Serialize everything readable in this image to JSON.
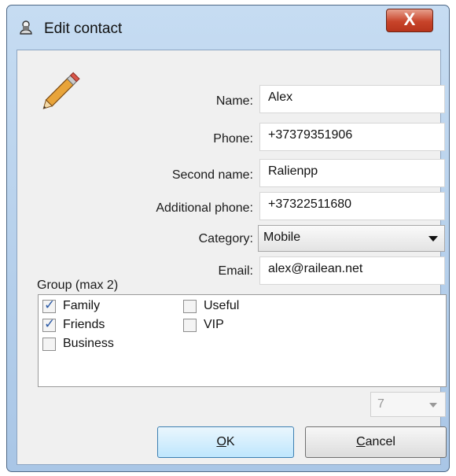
{
  "window": {
    "title": "Edit contact",
    "close_glyph": "X"
  },
  "form": {
    "name": {
      "label": "Name:",
      "value": "Alex"
    },
    "phone": {
      "label": "Phone:",
      "value": "+37379351906"
    },
    "second_name": {
      "label": "Second name:",
      "value": "Ralienpp"
    },
    "additional_phone": {
      "label": "Additional phone:",
      "value": "+37322511680"
    },
    "category": {
      "label": "Category:",
      "value": "Mobile"
    },
    "email": {
      "label": "Email:",
      "value": "alex@railean.net"
    }
  },
  "group": {
    "label": "Group (max 2)",
    "items": [
      {
        "label": "Family",
        "checked": true
      },
      {
        "label": "Friends",
        "checked": true
      },
      {
        "label": "Business",
        "checked": false
      },
      {
        "label": "Useful",
        "checked": false
      },
      {
        "label": "VIP",
        "checked": false
      }
    ]
  },
  "spinner": {
    "value": "7"
  },
  "buttons": {
    "ok": {
      "mnemonic": "O",
      "rest": "K"
    },
    "cancel": {
      "mnemonic": "C",
      "rest": "ancel"
    }
  },
  "icons": {
    "title": "contact-card-icon",
    "header": "pencil-icon",
    "close": "close-icon"
  },
  "colors": {
    "close_button": "#c8442a",
    "check_mark": "#2c5aa5",
    "ok_border": "#3c7fb1"
  }
}
